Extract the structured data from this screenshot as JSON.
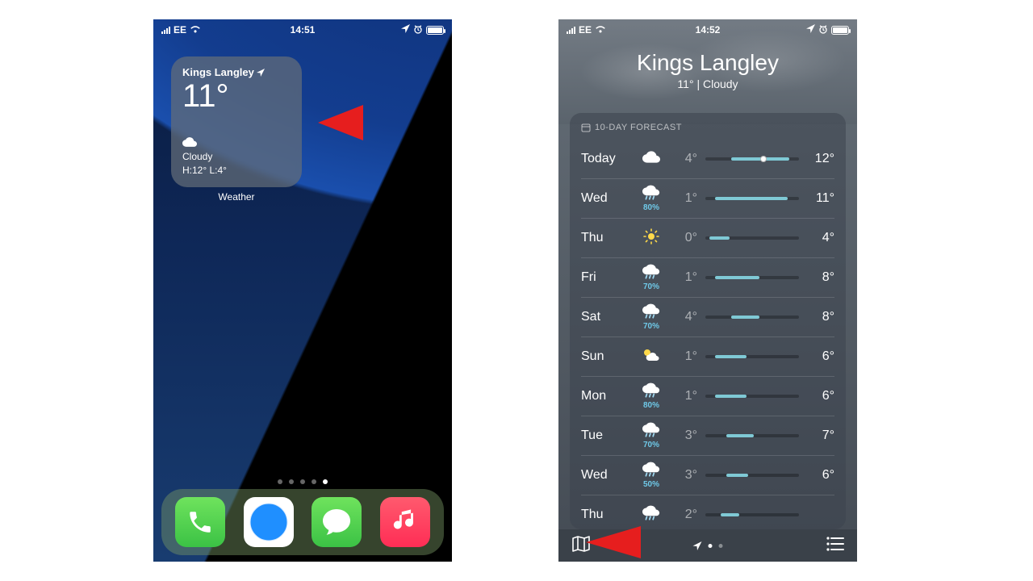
{
  "phone1": {
    "status": {
      "carrier": "EE",
      "time": "14:51"
    },
    "widget": {
      "location": "Kings Langley",
      "temp": "11°",
      "condition": "Cloudy",
      "hilo": "H:12° L:4°"
    },
    "widget_label": "Weather",
    "apps": [
      "Phone",
      "Safari",
      "Messages",
      "Music"
    ]
  },
  "phone2": {
    "status": {
      "carrier": "EE",
      "time": "14:52"
    },
    "header": {
      "city": "Kings Langley",
      "sub": "11°  |  Cloudy"
    },
    "panel_title": "10-DAY FORECAST",
    "forecast": [
      {
        "day": "Today",
        "icon": "cloud",
        "perc": "",
        "lo": "4°",
        "hi": "12°",
        "bs": 28,
        "bw": 62,
        "dot": true
      },
      {
        "day": "Wed",
        "icon": "rain",
        "perc": "80%",
        "lo": "1°",
        "hi": "11°",
        "bs": 10,
        "bw": 78,
        "dot": false
      },
      {
        "day": "Thu",
        "icon": "sun",
        "perc": "",
        "lo": "0°",
        "hi": "4°",
        "bs": 4,
        "bw": 22,
        "dot": false
      },
      {
        "day": "Fri",
        "icon": "rain",
        "perc": "70%",
        "lo": "1°",
        "hi": "8°",
        "bs": 10,
        "bw": 48,
        "dot": false
      },
      {
        "day": "Sat",
        "icon": "rain",
        "perc": "70%",
        "lo": "4°",
        "hi": "8°",
        "bs": 28,
        "bw": 30,
        "dot": false
      },
      {
        "day": "Sun",
        "icon": "partly",
        "perc": "",
        "lo": "1°",
        "hi": "6°",
        "bs": 10,
        "bw": 34,
        "dot": false
      },
      {
        "day": "Mon",
        "icon": "rain",
        "perc": "80%",
        "lo": "1°",
        "hi": "6°",
        "bs": 10,
        "bw": 34,
        "dot": false
      },
      {
        "day": "Tue",
        "icon": "rain",
        "perc": "70%",
        "lo": "3°",
        "hi": "7°",
        "bs": 22,
        "bw": 30,
        "dot": false
      },
      {
        "day": "Wed",
        "icon": "rain",
        "perc": "50%",
        "lo": "3°",
        "hi": "6°",
        "bs": 22,
        "bw": 24,
        "dot": false
      },
      {
        "day": "Thu",
        "icon": "rain",
        "perc": "",
        "lo": "2°",
        "hi": "",
        "bs": 16,
        "bw": 20,
        "dot": false
      }
    ]
  }
}
